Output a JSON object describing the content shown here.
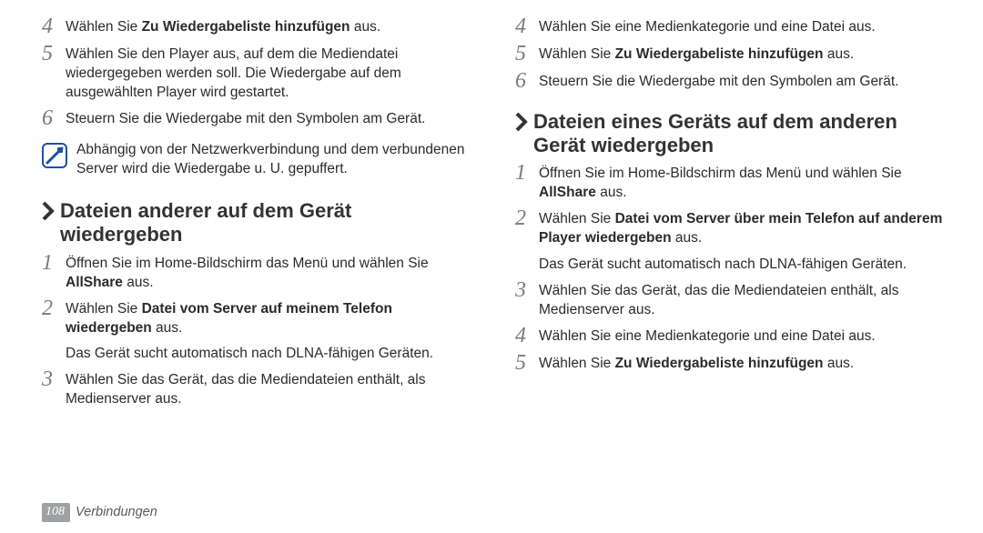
{
  "left": {
    "steps_a": [
      {
        "n": "4",
        "pre": "Wählen Sie ",
        "bold": "Zu Wiedergabeliste hinzufügen",
        "post": " aus."
      },
      {
        "n": "5",
        "text": "Wählen Sie den Player aus, auf dem die Mediendatei wiedergegeben werden soll. Die Wiedergabe auf dem ausgewählten Player wird gestartet."
      },
      {
        "n": "6",
        "text": "Steuern Sie die Wiedergabe mit den Symbolen am Gerät."
      }
    ],
    "note": "Abhängig von der Netzwerkverbindung und dem verbundenen Server wird die Wiedergabe u. U. gepuffert.",
    "heading": "Dateien anderer auf dem Gerät wiedergeben",
    "steps_b": [
      {
        "n": "1",
        "pre": "Öffnen Sie im Home-Bildschirm das Menü und wählen Sie ",
        "bold": "AllShare",
        "post": " aus."
      },
      {
        "n": "2",
        "pre": "Wählen Sie ",
        "bold": "Datei vom Server auf meinem Telefon wiedergeben",
        "post": " aus.",
        "sub": "Das Gerät sucht automatisch nach DLNA-fähigen Geräten."
      },
      {
        "n": "3",
        "text": "Wählen Sie das Gerät, das die Mediendateien enthält, als Medienserver aus."
      }
    ]
  },
  "right": {
    "steps_a": [
      {
        "n": "4",
        "text": "Wählen Sie eine Medienkategorie und eine Datei aus."
      },
      {
        "n": "5",
        "pre": "Wählen Sie ",
        "bold": "Zu Wiedergabeliste hinzufügen",
        "post": " aus."
      },
      {
        "n": "6",
        "text": "Steuern Sie die Wiedergabe mit den Symbolen am Gerät."
      }
    ],
    "heading": "Dateien eines Geräts auf dem anderen Gerät wiedergeben",
    "steps_b": [
      {
        "n": "1",
        "pre": "Öffnen Sie im Home-Bildschirm das Menü und wählen Sie ",
        "bold": "AllShare",
        "post": " aus."
      },
      {
        "n": "2",
        "pre": "Wählen Sie ",
        "bold": "Datei vom Server über mein Telefon auf anderem Player wiedergeben",
        "post": " aus.",
        "sub": "Das Gerät sucht automatisch nach DLNA-fähigen Geräten."
      },
      {
        "n": "3",
        "text": "Wählen Sie das Gerät, das die Mediendateien enthält, als Medienserver aus."
      },
      {
        "n": "4",
        "text": "Wählen Sie eine Medienkategorie und eine Datei aus."
      },
      {
        "n": "5",
        "pre": "Wählen Sie ",
        "bold": "Zu Wiedergabeliste hinzufügen",
        "post": " aus."
      }
    ]
  },
  "footer": {
    "page": "108",
    "section": "Verbindungen"
  }
}
